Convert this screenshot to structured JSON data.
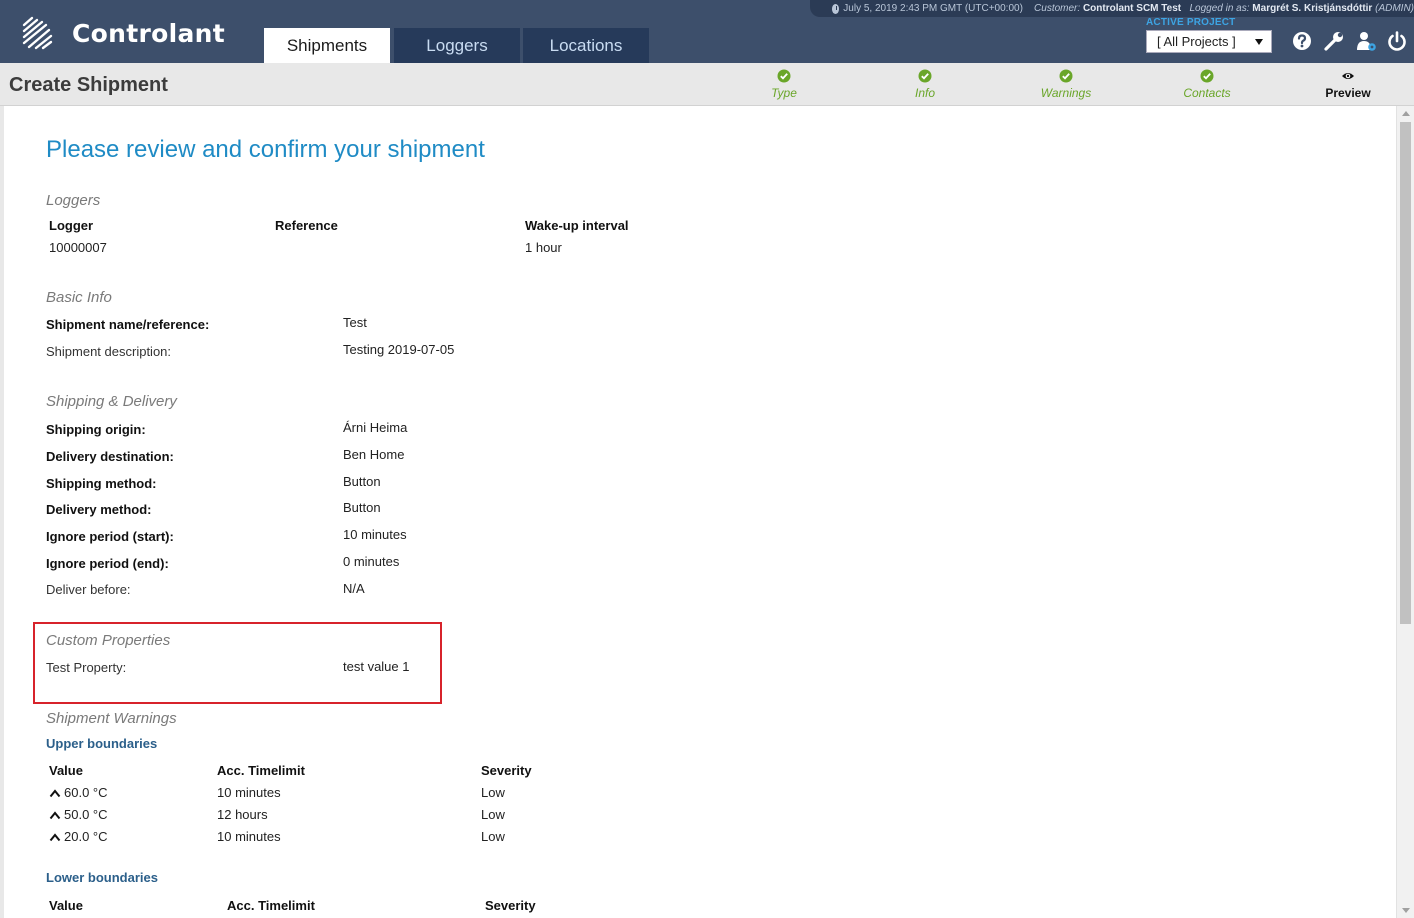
{
  "app": {
    "brand": "Controlant",
    "nav_tabs": [
      {
        "label": "Shipments",
        "active": true
      },
      {
        "label": "Loggers",
        "active": false
      },
      {
        "label": "Locations",
        "active": false
      }
    ],
    "status": {
      "datetime": "July 5, 2019 2:43 PM GMT (UTC+00:00)",
      "customer_label": "Customer:",
      "customer": "Controlant SCM Test",
      "logged_in_label": "Logged in as:",
      "user": "Margrét S. Kristjánsdóttir",
      "role": "(ADMIN)"
    },
    "active_project_label": "ACTIVE PROJECT",
    "active_project_value": "[ All Projects ]",
    "icons": [
      "help-icon",
      "wrench-icon",
      "users-icon",
      "power-icon"
    ],
    "colors": {
      "header": "#3d4f6b",
      "accent": "#1f8bc5",
      "step_done": "#6aa629",
      "highlight": "#d7232b"
    }
  },
  "page": {
    "title": "Create Shipment",
    "steps": [
      {
        "label": "Type",
        "state": "done"
      },
      {
        "label": "Info",
        "state": "done"
      },
      {
        "label": "Warnings",
        "state": "done"
      },
      {
        "label": "Contacts",
        "state": "done"
      },
      {
        "label": "Preview",
        "state": "current"
      }
    ]
  },
  "review": {
    "heading": "Please review and confirm your shipment",
    "loggers": {
      "section": "Loggers",
      "headers": [
        "Logger",
        "Reference",
        "Wake-up interval"
      ],
      "rows": [
        [
          "10000007",
          "",
          "1 hour"
        ]
      ]
    },
    "basic_info": {
      "section": "Basic Info",
      "fields": [
        {
          "label": "Shipment name/reference:",
          "value": "Test"
        },
        {
          "label": "Shipment description:",
          "value": "Testing 2019-07-05"
        }
      ]
    },
    "shipping_delivery": {
      "section": "Shipping & Delivery",
      "fields": [
        {
          "label": "Shipping origin:",
          "value": "Árni Heima"
        },
        {
          "label": "Delivery destination:",
          "value": "Ben Home"
        },
        {
          "label": "Shipping method:",
          "value": "Button"
        },
        {
          "label": "Delivery method:",
          "value": "Button"
        },
        {
          "label": "Ignore period (start):",
          "value": "10 minutes"
        },
        {
          "label": "Ignore period (end):",
          "value": "0 minutes"
        },
        {
          "label": "Deliver before:",
          "value": "N/A"
        }
      ]
    },
    "custom_properties": {
      "section": "Custom Properties",
      "fields": [
        {
          "label": "Test Property:",
          "value": "test value 1"
        }
      ]
    },
    "warnings": {
      "section": "Shipment Warnings",
      "upper_title": "Upper boundaries",
      "upper_headers": [
        "Value",
        "Acc. Timelimit",
        "Severity"
      ],
      "upper_rows": [
        [
          "60.0 °C",
          "10 minutes",
          "Low"
        ],
        [
          "50.0 °C",
          "12 hours",
          "Low"
        ],
        [
          "20.0 °C",
          "10 minutes",
          "Low"
        ]
      ],
      "lower_title": "Lower boundaries",
      "lower_headers": [
        "Value",
        "Acc. Timelimit",
        "Severity"
      ]
    }
  }
}
